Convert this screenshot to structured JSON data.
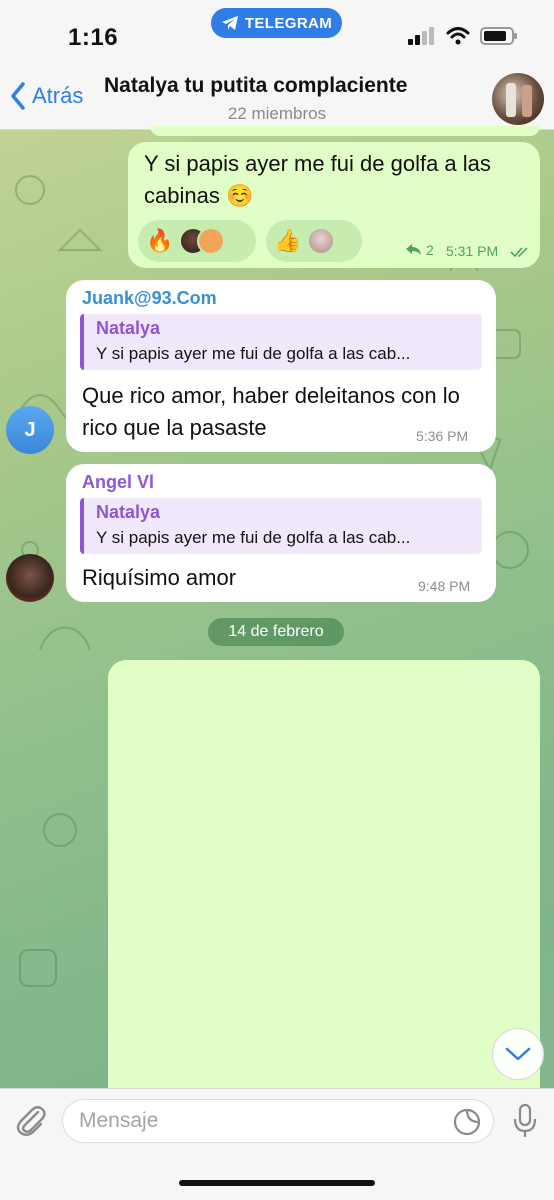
{
  "status_bar": {
    "time": "1:16",
    "app_pill": "TELEGRAM"
  },
  "nav": {
    "back_label": "Atrás",
    "title": "Natalya tu putita complaciente",
    "subtitle": "22 miembros"
  },
  "messages": [
    {
      "type": "outgoing",
      "text": "Y si papis ayer me fui de golfa a las cabinas ☺️",
      "reactions": [
        {
          "emoji": "🔥",
          "icon": "fire-emoji"
        },
        {
          "emoji": "👍",
          "icon": "thumbs-up-emoji"
        }
      ],
      "replies_count": "2",
      "time": "5:31 PM"
    },
    {
      "type": "incoming",
      "sender": "Juank@93.Com",
      "sender_color": "#3b8fd6",
      "avatar_letter": "J",
      "reply_to": {
        "name": "Natalya",
        "text": "Y si papis ayer me fui de golfa a las cab..."
      },
      "text": "Que rico amor, haber deleitanos con lo rico que la pasaste",
      "time": "5:36 PM"
    },
    {
      "type": "incoming",
      "sender": "Angel Vl",
      "sender_color": "#8e55d6",
      "reply_to": {
        "name": "Natalya",
        "text": "Y si papis ayer me fui de golfa a las cab..."
      },
      "text": "Riquísimo amor",
      "time": "9:48 PM"
    }
  ],
  "date_separator": "14 de febrero",
  "composer": {
    "placeholder": "Mensaje"
  },
  "colors": {
    "accent": "#2f7ee8",
    "outgoing_bubble": "#e1fec6",
    "incoming_bubble": "#ffffff"
  }
}
